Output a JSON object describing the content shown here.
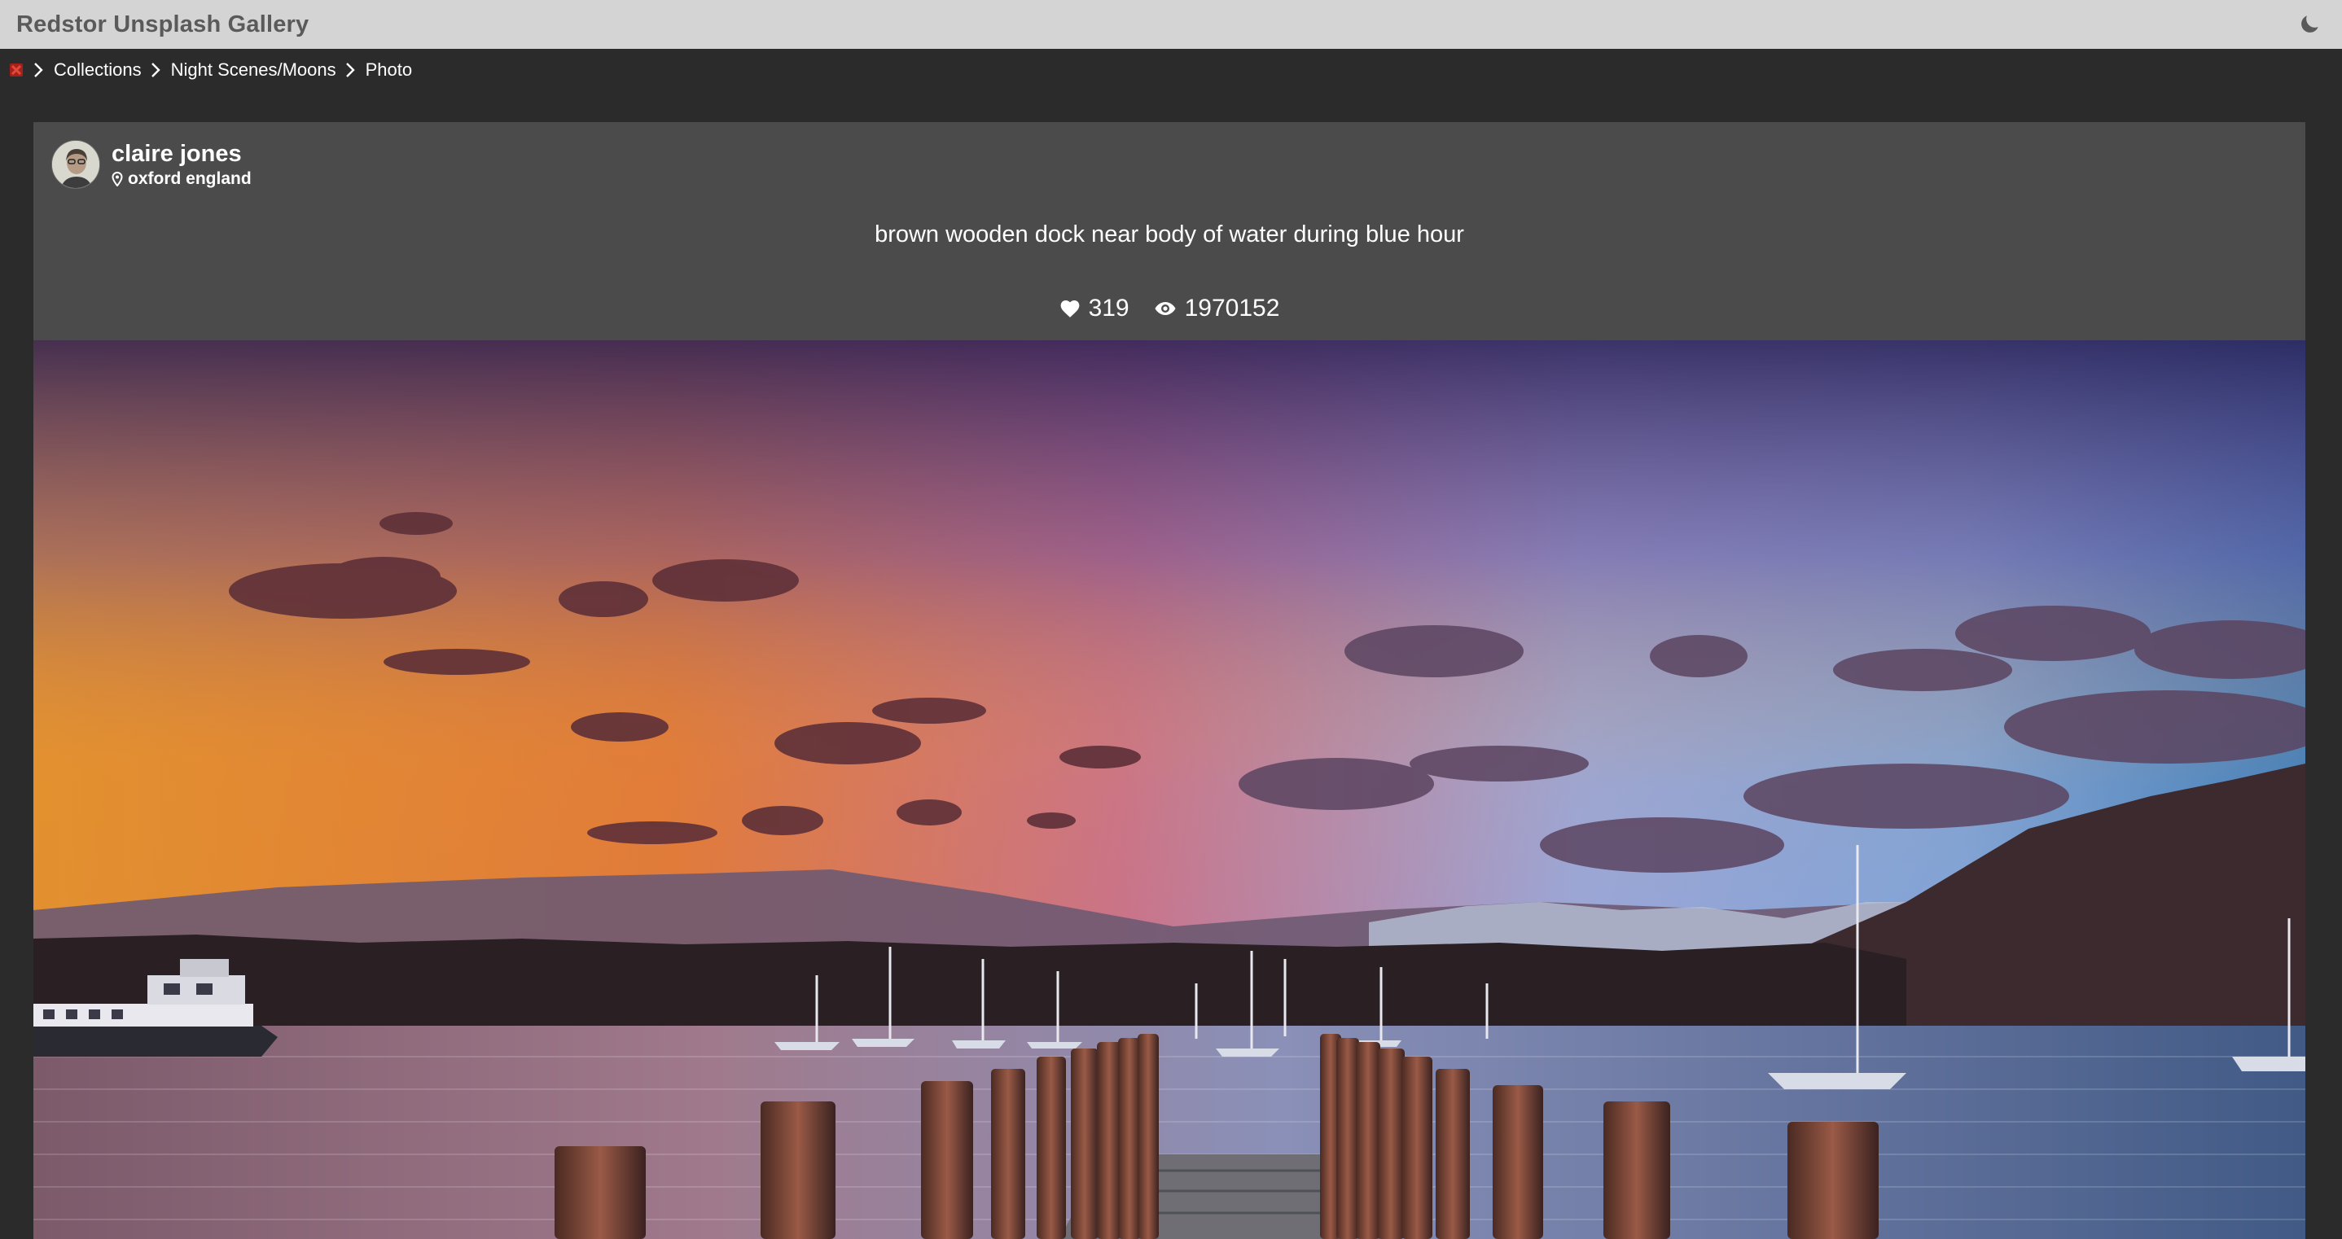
{
  "app": {
    "title": "Redstor Unsplash Gallery",
    "theme_icon": "moon-icon"
  },
  "breadcrumb": {
    "home_icon": "home-logo-icon",
    "items": [
      {
        "label": "Collections"
      },
      {
        "label": "Night Scenes/Moons"
      },
      {
        "label": "Photo"
      }
    ]
  },
  "photo": {
    "author": {
      "name": "claire jones",
      "location": "oxford england"
    },
    "description": "brown wooden dock near body of water during blue hour",
    "likes": "319",
    "views": "1970152"
  },
  "colors": {
    "topbar": "#d4d4d4",
    "background": "#2b2b2b",
    "card": "#4a4a4a",
    "brand_red": "#c0392b"
  }
}
